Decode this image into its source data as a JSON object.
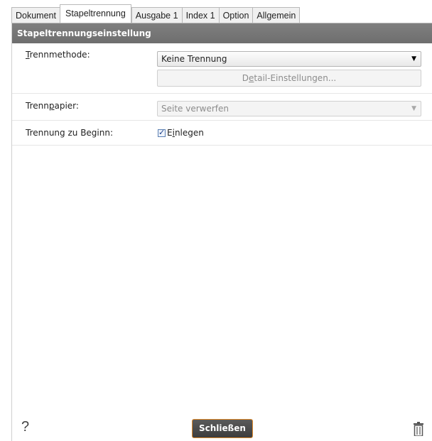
{
  "tabs": [
    {
      "label": "Dokument"
    },
    {
      "label": "Stapeltrennung"
    },
    {
      "label": "Ausgabe 1"
    },
    {
      "label": "Index 1"
    },
    {
      "label": "Option"
    },
    {
      "label": "Allgemein"
    }
  ],
  "active_tab": "Stapeltrennung",
  "section": {
    "title": "Stapeltrennungseinstellung"
  },
  "rows": {
    "method": {
      "label_prefix": "",
      "label_mnemonic": "T",
      "label_rest": "rennmethode:",
      "value": "Keine Trennung",
      "detail_prefix": "D",
      "detail_mnemonic": "e",
      "detail_rest": "tail-Einstellungen..."
    },
    "paper": {
      "label_prefix": "Trenn",
      "label_mnemonic": "p",
      "label_rest": "apier:",
      "value": "Seite verwerfen"
    },
    "begin": {
      "label": "Trennung zu Beginn:",
      "checkbox_checked": true,
      "checkbox_prefix": "E",
      "checkbox_mnemonic": "i",
      "checkbox_rest": "nlegen"
    }
  },
  "footer": {
    "help": "?",
    "close_label": "Schließen",
    "trash_icon": "trash-icon"
  },
  "colors": {
    "header_bg": "#757575",
    "close_border": "#e08a2c",
    "close_bg": "#4a4a4a"
  }
}
